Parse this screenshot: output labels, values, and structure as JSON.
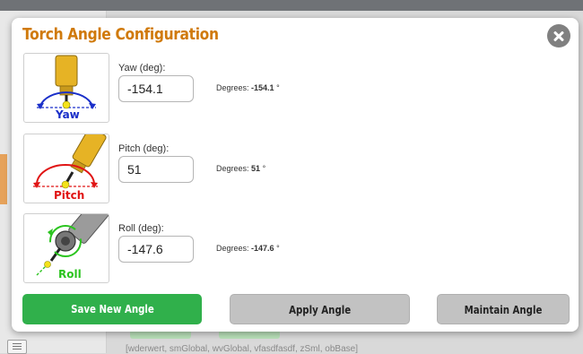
{
  "background": {
    "footer_text": "[wderwert, smGlobal, wvGlobal, vfasdfasdf, zSml, obBase]"
  },
  "modal": {
    "title": "Torch Angle Configuration",
    "close_icon": "close-circle-icon"
  },
  "rows": [
    {
      "thumb_label": "Yaw",
      "field_label": "Yaw (deg):",
      "value": "-154.1",
      "degrees_prefix": "Degrees:",
      "degrees_value": "-154.1",
      "degrees_unit": "°",
      "icon": "yaw-torch-icon"
    },
    {
      "thumb_label": "Pitch",
      "field_label": "Pitch (deg):",
      "value": "51",
      "degrees_prefix": "Degrees:",
      "degrees_value": "51",
      "degrees_unit": "°",
      "icon": "pitch-torch-icon"
    },
    {
      "thumb_label": "Roll",
      "field_label": "Roll (deg):",
      "value": "-147.6",
      "degrees_prefix": "Degrees:",
      "degrees_value": "-147.6",
      "degrees_unit": "°",
      "icon": "roll-torch-icon"
    }
  ],
  "buttons": {
    "save": "Save New Angle",
    "apply": "Apply Angle",
    "maintain": "Maintain Angle"
  },
  "colors": {
    "title": "#d07a0b",
    "save": "#30b04b",
    "secondary": "#c2c2c2",
    "yaw": "#1a2fc9",
    "pitch": "#e01414",
    "roll": "#2bc41f"
  }
}
